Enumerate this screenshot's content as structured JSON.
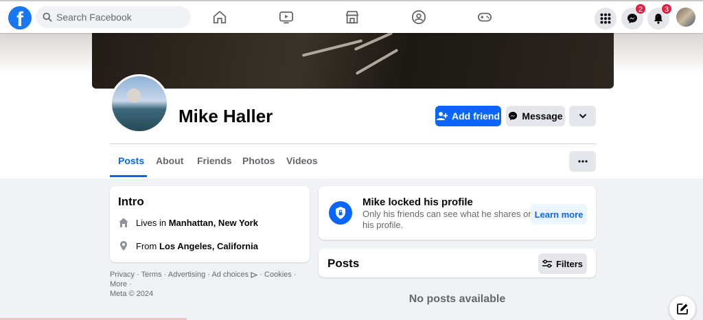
{
  "topbar": {
    "logo": "f",
    "search_placeholder": "Search Facebook",
    "nav_icons": [
      "home-icon",
      "watch-icon",
      "marketplace-icon",
      "groups-icon",
      "gaming-icon"
    ],
    "messenger_badge": "2",
    "notifications_badge": "3"
  },
  "profile": {
    "name": "Mike Haller",
    "add_friend_label": "Add friend",
    "message_label": "Message"
  },
  "tabs": [
    {
      "label": "Posts",
      "active": true
    },
    {
      "label": "About"
    },
    {
      "label": "Friends"
    },
    {
      "label": "Photos"
    },
    {
      "label": "Videos"
    }
  ],
  "intro": {
    "title": "Intro",
    "lives_prefix": "Lives in",
    "lives_value": "Manhattan, New York",
    "from_prefix": "From",
    "from_value": "Los Angeles, California"
  },
  "footer": {
    "links": [
      "Privacy",
      "Terms",
      "Advertising",
      "Ad choices",
      "Cookies",
      "More"
    ],
    "copyright": "Meta © 2024"
  },
  "locked": {
    "title": "Mike locked his profile",
    "subtitle": "Only his friends can see what he shares on his profile.",
    "learn_more": "Learn more"
  },
  "posts": {
    "title": "Posts",
    "filters_label": "Filters",
    "empty_text": "No posts available"
  },
  "colors": {
    "brand_blue": "#0866ff",
    "badge_red": "#e41e3f"
  }
}
